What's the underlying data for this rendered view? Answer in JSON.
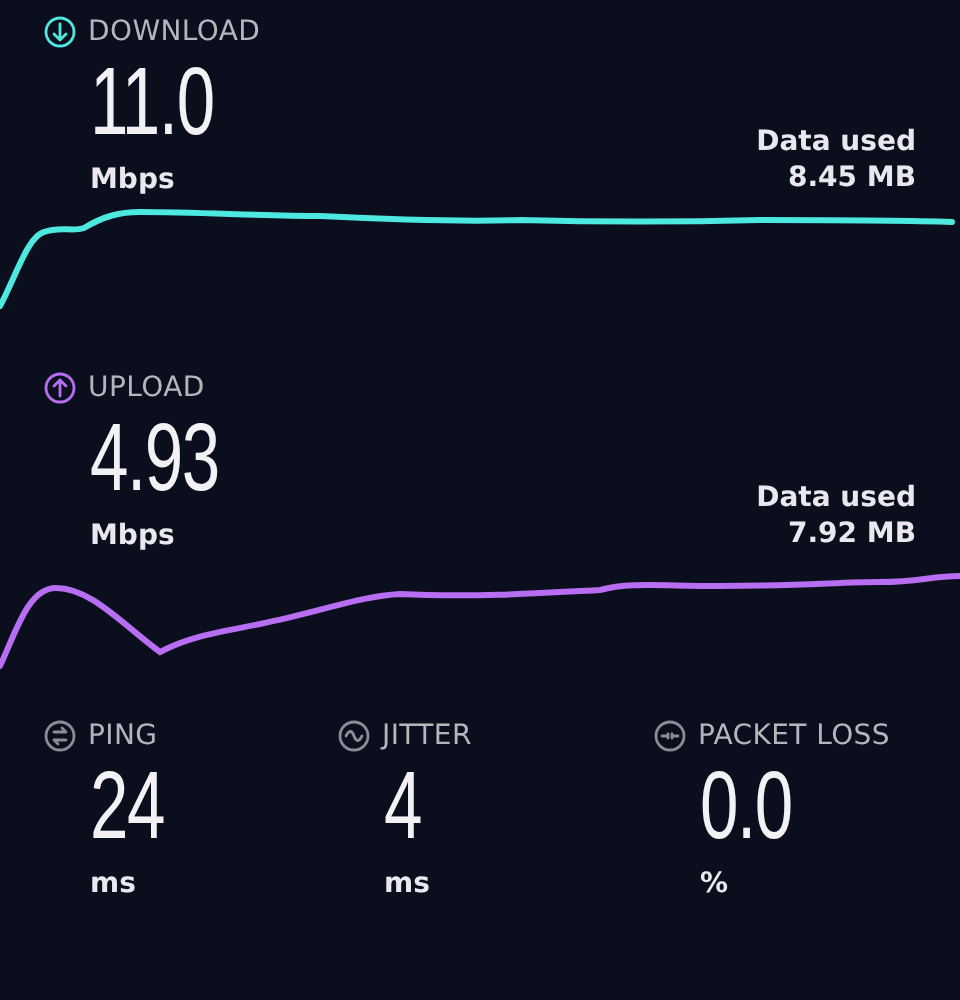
{
  "speeds": [
    {
      "kind": "download",
      "label": "DOWNLOAD",
      "color": "#4de8df",
      "value": "11.0",
      "unit": "Mbps",
      "data_label": "Data used",
      "data_value": "8.45 MB"
    },
    {
      "kind": "upload",
      "label": "UPLOAD",
      "color": "#b86ef2",
      "value": "4.93",
      "unit": "Mbps",
      "data_label": "Data used",
      "data_value": "7.92 MB"
    }
  ],
  "metrics": [
    {
      "kind": "ping",
      "label": "PING",
      "value": "24",
      "unit": "ms"
    },
    {
      "kind": "jitter",
      "label": "JITTER",
      "value": "4",
      "unit": "ms"
    },
    {
      "kind": "packet_loss",
      "label": "PACKET LOSS",
      "value": "0.0",
      "unit": "%"
    }
  ]
}
